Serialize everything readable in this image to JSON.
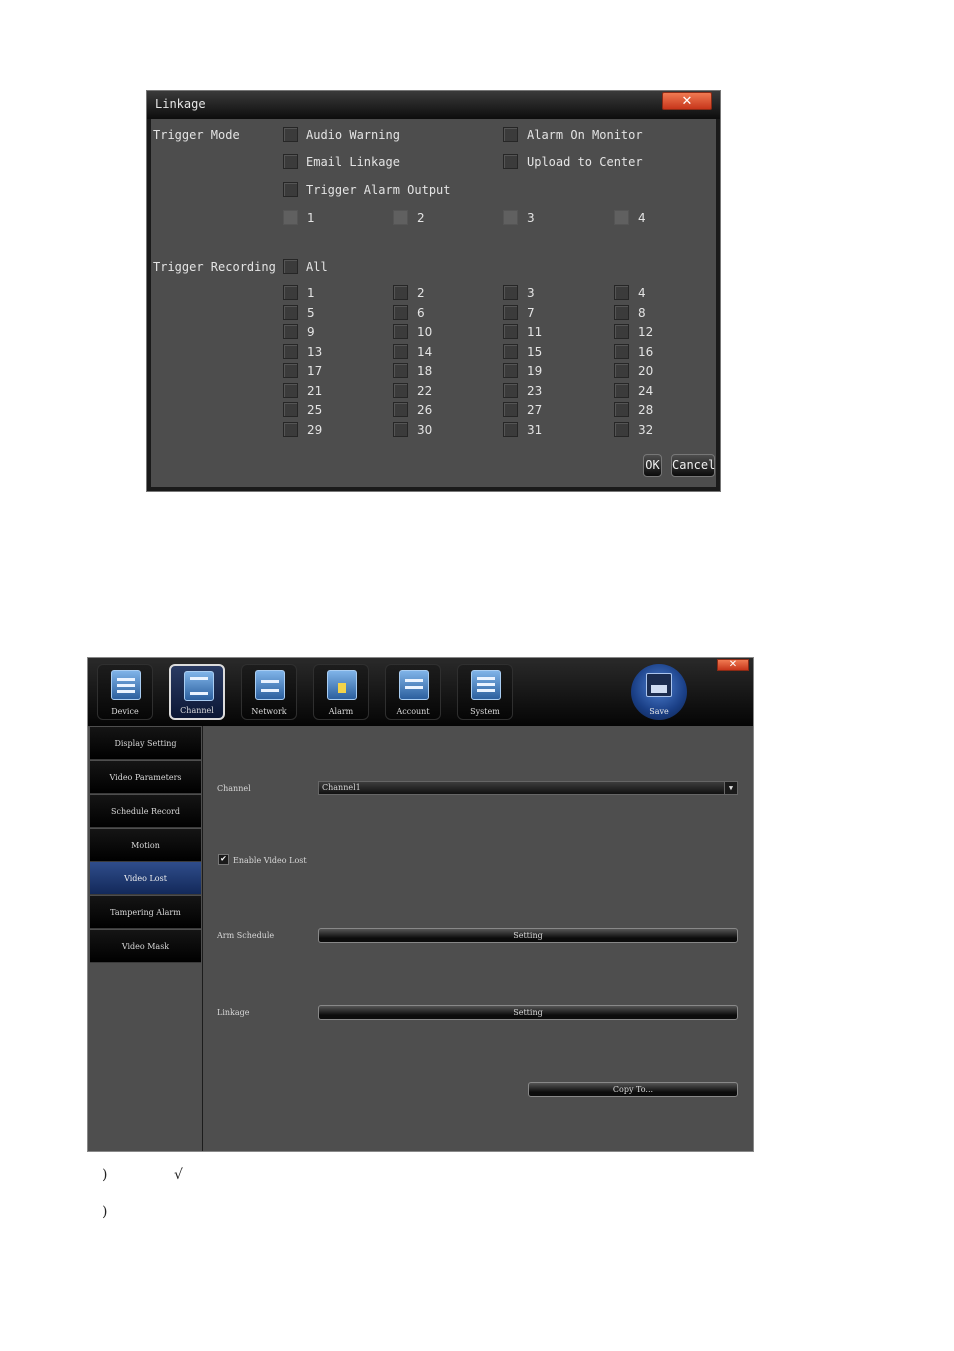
{
  "linkage_dialog": {
    "title": "Linkage",
    "close_symbol": "✕",
    "trigger_mode_label": "Trigger Mode",
    "audio_warning": "Audio Warning",
    "alarm_on_monitor": "Alarm On Monitor",
    "email_linkage": "Email Linkage",
    "upload_to_center": "Upload to Center",
    "trigger_alarm_output": "Trigger Alarm Output",
    "alarm_outputs": [
      "1",
      "2",
      "3",
      "4"
    ],
    "trigger_recording_label": "Trigger Recording",
    "all_label": "All",
    "channels": [
      "1",
      "2",
      "3",
      "4",
      "5",
      "6",
      "7",
      "8",
      "9",
      "10",
      "11",
      "12",
      "13",
      "14",
      "15",
      "16",
      "17",
      "18",
      "19",
      "20",
      "21",
      "22",
      "23",
      "24",
      "25",
      "26",
      "27",
      "28",
      "29",
      "30",
      "31",
      "32"
    ],
    "ok_label": "OK",
    "cancel_label": "Cancel"
  },
  "main_window": {
    "close_symbol": "✕",
    "toolbar": [
      "Device",
      "Channel",
      "Network",
      "Alarm",
      "Account",
      "System"
    ],
    "active_toolbar": "Channel",
    "save_label": "Save",
    "sidebar": [
      "Display Setting",
      "Video Parameters",
      "Schedule Record",
      "Motion",
      "Video Lost",
      "Tampering Alarm",
      "Video Mask"
    ],
    "active_sidebar": "Video Lost",
    "channel_label": "Channel",
    "channel_value": "Channel1",
    "enable_video_lost": "Enable Video Lost",
    "enable_video_lost_checked": true,
    "check_mark": "✔",
    "arm_schedule_label": "Arm Schedule",
    "linkage_label": "Linkage",
    "setting_label": "Setting",
    "copy_to_label": "Copy To..."
  },
  "footer": {
    "line1_paren": ")",
    "line1_mark": "√",
    "line2_paren": ")"
  },
  "colors": {
    "dialog_body": "#4d4d4d",
    "titlebar": "#0d0d0d",
    "close_button": "#d9482a",
    "active_tab": "#2f4d8b"
  }
}
